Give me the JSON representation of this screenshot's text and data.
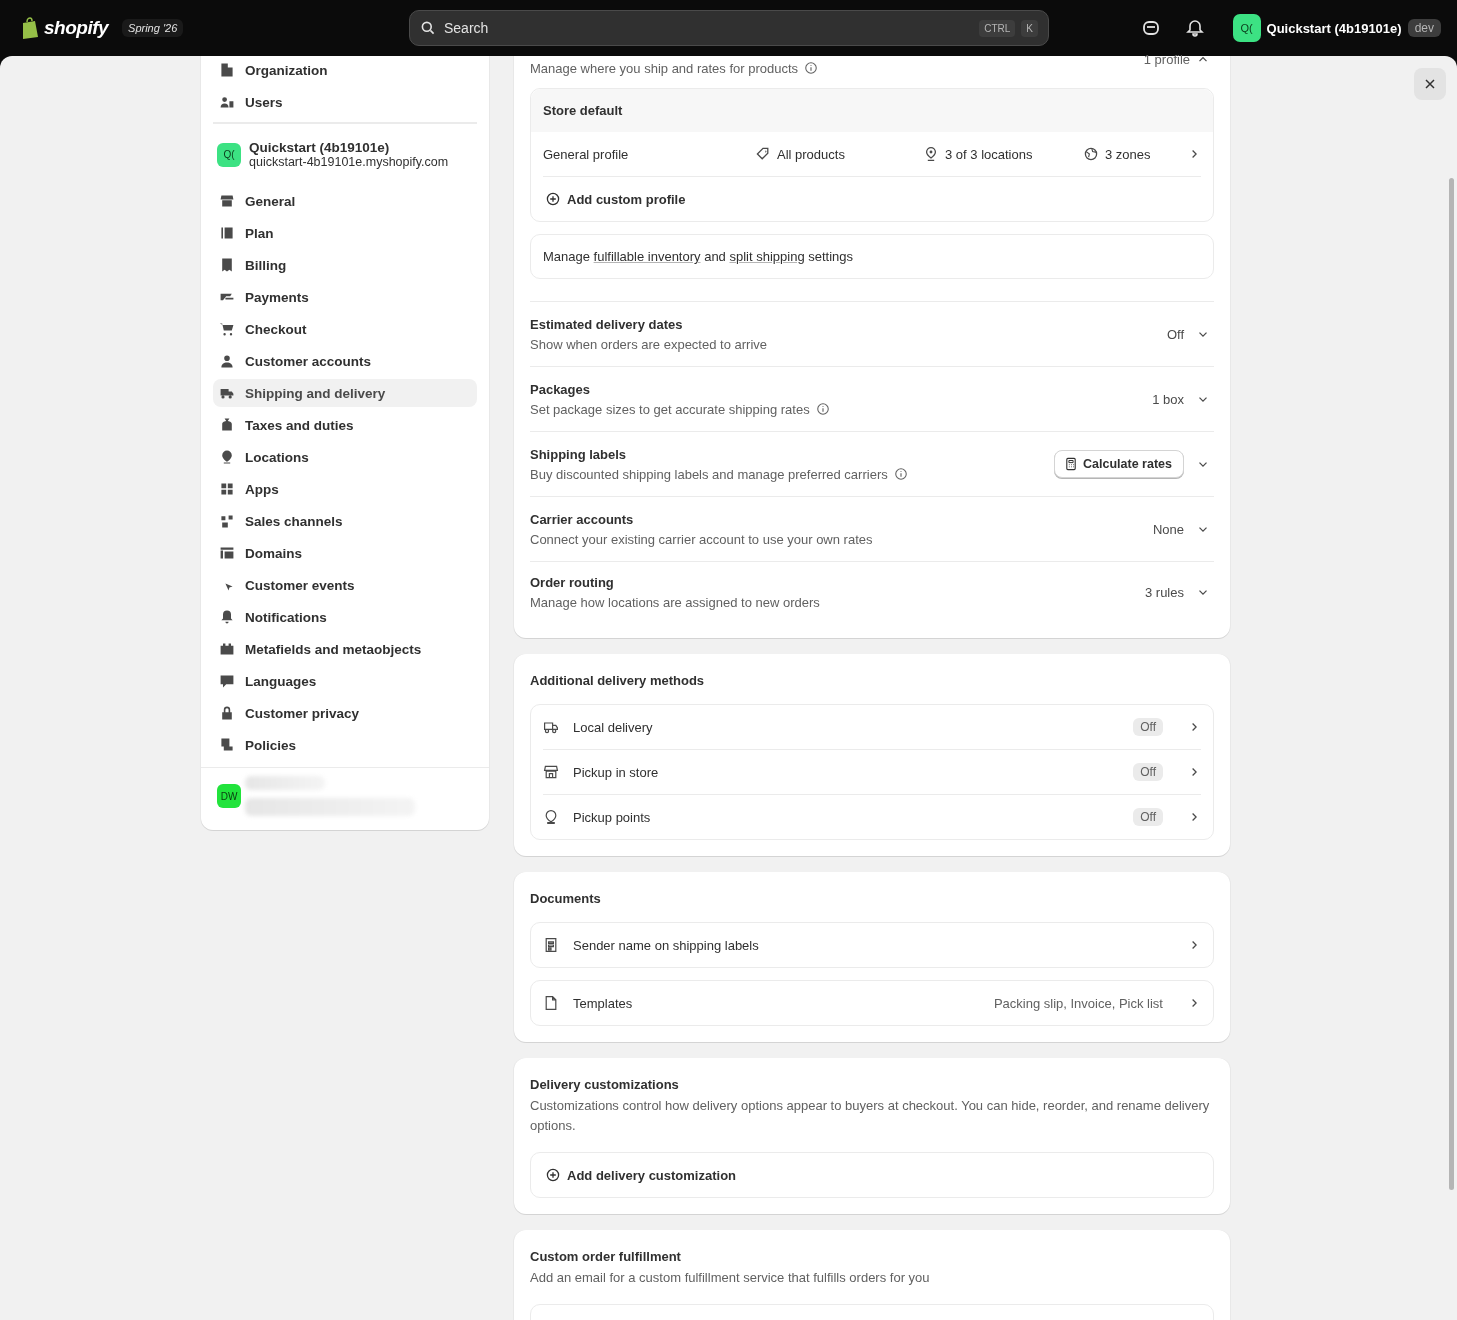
{
  "topbar": {
    "logo_text": "shopify",
    "edition": "Spring '26",
    "search": {
      "placeholder": "Search",
      "shortcut": [
        "CTRL",
        "K"
      ]
    },
    "store": {
      "initials": "Q(",
      "name": "Quickstart (4b19101e)",
      "badge": "dev"
    }
  },
  "sidebar": {
    "top_items": [
      {
        "label": "Organization",
        "selected": false
      },
      {
        "label": "Users",
        "selected": false
      }
    ],
    "store": {
      "initials": "Q(",
      "name": "Quickstart (4b19101e)",
      "domain": "quickstart-4b19101e.myshopify.com"
    },
    "items": [
      {
        "label": "General",
        "selected": false
      },
      {
        "label": "Plan",
        "selected": false
      },
      {
        "label": "Billing",
        "selected": false
      },
      {
        "label": "Payments",
        "selected": false
      },
      {
        "label": "Checkout",
        "selected": false
      },
      {
        "label": "Customer accounts",
        "selected": false
      },
      {
        "label": "Shipping and delivery",
        "selected": true
      },
      {
        "label": "Taxes and duties",
        "selected": false
      },
      {
        "label": "Locations",
        "selected": false
      },
      {
        "label": "Apps",
        "selected": false
      },
      {
        "label": "Sales channels",
        "selected": false
      },
      {
        "label": "Domains",
        "selected": false
      },
      {
        "label": "Customer events",
        "selected": false
      },
      {
        "label": "Notifications",
        "selected": false
      },
      {
        "label": "Metafields and metaobjects",
        "selected": false
      },
      {
        "label": "Languages",
        "selected": false
      },
      {
        "label": "Customer privacy",
        "selected": false
      },
      {
        "label": "Policies",
        "selected": false
      }
    ],
    "user": {
      "initials": "DW"
    }
  },
  "shipping": {
    "subtitle": "Manage where you ship and rates for products",
    "info": true,
    "summary": "1 profile",
    "expanded": true,
    "group": {
      "title": "Store default",
      "profiles": [
        {
          "name": "General profile",
          "products": "All products",
          "locations": "3 of 3 locations",
          "zones": "3 zones"
        }
      ],
      "add_label": "Add custom profile"
    },
    "inventory_note": {
      "prefix": "Manage",
      "link_1": "fulfillable inventory",
      "middle": "and",
      "link_2": "split shipping",
      "suffix": "settings"
    },
    "settings": [
      {
        "kind": "value",
        "title": "Estimated delivery dates",
        "description": "Show when orders are expected to arrive",
        "info": false,
        "value": "Off",
        "expanded": false
      },
      {
        "kind": "value",
        "title": "Packages",
        "description": "Set package sizes to get accurate shipping rates",
        "info": true,
        "value": "1 box",
        "expanded": false
      },
      {
        "kind": "button",
        "title": "Shipping labels",
        "description": "Buy discounted shipping labels and manage preferred carriers",
        "info": true,
        "value": "Calculate rates",
        "expanded": false
      },
      {
        "kind": "value",
        "title": "Carrier accounts",
        "description": "Connect your existing carrier account to use your own rates",
        "info": false,
        "value": "None",
        "expanded": false
      },
      {
        "kind": "value",
        "title": "Order routing",
        "description": "Manage how locations are assigned to new orders",
        "info": false,
        "value": "3 rules",
        "expanded": false
      }
    ]
  },
  "additional_methods": {
    "title": "Additional delivery methods",
    "methods": [
      {
        "label": "Local delivery",
        "status": "Off"
      },
      {
        "label": "Pickup in store",
        "status": "Off"
      },
      {
        "label": "Pickup points",
        "status": "Off"
      }
    ]
  },
  "documents": {
    "title": "Documents",
    "items": [
      {
        "label": "Sender name on shipping labels",
        "value": null
      },
      {
        "label": "Templates",
        "value": "Packing slip, Invoice, Pick list"
      }
    ]
  },
  "delivery_customizations": {
    "title": "Delivery customizations",
    "description": "Customizations control how delivery options appear to buyers at checkout. You can hide, reorder, and rename delivery options.",
    "add_label": "Add delivery customization"
  },
  "custom_fulfillment": {
    "title": "Custom order fulfillment",
    "description": "Add an email for a custom fulfillment service that fulfills orders for you"
  }
}
